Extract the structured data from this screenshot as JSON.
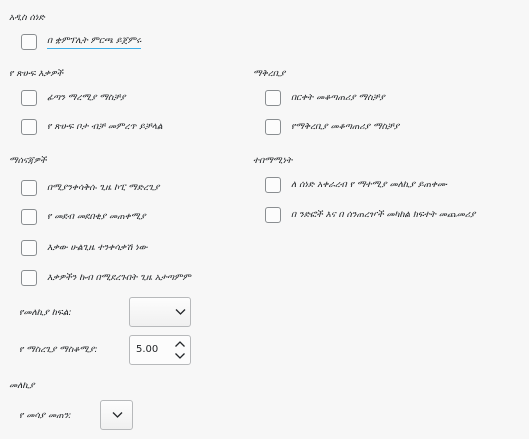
{
  "sections": {
    "title_text": "አዲስ ሰነድ",
    "tabs_groups": "የ ጽሁፍ እቃዎች",
    "window": "ማቅረቢያ",
    "options": "ማሰናጃዎች",
    "navigation": "ተበማሚነት",
    "image": "መለኪያ"
  },
  "checkboxes": {
    "open_last_doc": "በ ቋምፕሊት ምርጫ ይጀምሩ",
    "show_ruler": "ፊጣን ማረሚያ ማስቻያ",
    "text_field_grid": "የ ጽሁፍ ቦታ ብቻ መምረጥ ይቻላል",
    "right_border": "በርቀት መቆጣጠሪያ ማስቻያ",
    "presenter_border": "የማቅረቢያ መቆጣጠሪያ ማስቻያ",
    "object_copy_shortcut": "በሚያንቀሳቅሱ ጊዜ ኮፒ ማድረጊያ",
    "object_always_move": "የ መደብ መደበቂያ መጠቀሚያ",
    "no_distort": "እቃው ሁልጊዜ ተንቀሳቃሽ ነው",
    "smooth_edges": "እቃዎችን ኩብ በሚደረጉበት ጊዜ አታጣምም",
    "printer_metrics": "ለ ሰነድ አቀራረብ የ ማተሚያ መለኪያ ይጠቀሙ",
    "add_spacing": "በ ንድፎች እና በ ሰንጠረዦች መካከል ክፍተት መጨመሪያ"
  },
  "fields": {
    "unit_label": "የመለኪያ ከፍል:",
    "unit_value": "",
    "tab_stops_label": "የ ማስረጊያ ማስቆሚያ:",
    "tab_stops_value": "5.00",
    "paper_format_label": "የ መሳያ መጠን:",
    "paper_format_value": ""
  },
  "icons": {
    "dropdown": "chevron-down-icon",
    "spin_up": "chevron-up-icon",
    "spin_down": "chevron-down-icon"
  },
  "colors": {
    "focus": "#3daee9",
    "background": "#f7f7f7"
  }
}
